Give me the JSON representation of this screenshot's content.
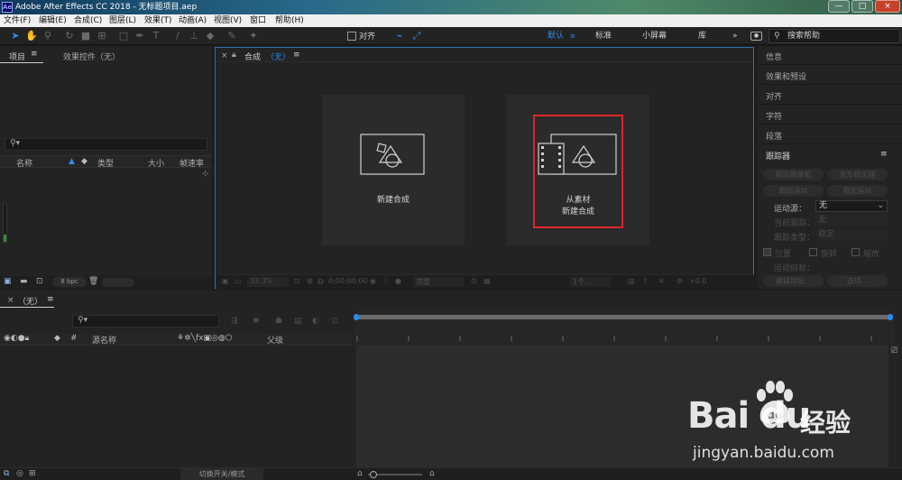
{
  "window": {
    "title": "Adobe After Effects CC 2018 - 无标题项目.aep",
    "app_icon": "Ae",
    "controls": [
      "minimize",
      "maximize",
      "close"
    ]
  },
  "menu": [
    "文件(F)",
    "编辑(E)",
    "合成(C)",
    "图层(L)",
    "效果(T)",
    "动画(A)",
    "视图(V)",
    "窗口",
    "帮助(H)"
  ],
  "toolbar": {
    "snap_label": "对齐",
    "workspaces": [
      {
        "label": "默认",
        "active": true
      },
      {
        "label": "标准",
        "active": false
      },
      {
        "label": "小屏幕",
        "active": false
      },
      {
        "label": "库",
        "active": false
      }
    ],
    "more": "»",
    "search_placeholder": "搜索帮助"
  },
  "project_panel": {
    "tab_project": "项目",
    "tab_effects": "效果控件（无）",
    "columns": [
      "名称",
      "类型",
      "大小",
      "帧速率"
    ],
    "bpc": "8 bpc"
  },
  "composition_panel": {
    "close": "×",
    "tab_label": "合成",
    "tab_value": "（无）",
    "cards": [
      {
        "label_lines": [
          "新建合成"
        ]
      },
      {
        "label_lines": [
          "从素材",
          "新建合成"
        ],
        "highlighted": true
      }
    ],
    "footer": {
      "zoom": "33.3%",
      "timecode": "0;00;00;00",
      "resolution": "完整",
      "view": "1个...",
      "offset": "+0.0"
    }
  },
  "right_panels": {
    "items": [
      "信息",
      "效果和预设",
      "对齐",
      "字符",
      "段落"
    ],
    "tracker": {
      "title": "跟踪器",
      "buttons": [
        "跟踪摄像机",
        "变形稳定器",
        "跟踪运动",
        "稳定运动"
      ],
      "motion_source_label": "运动源：",
      "motion_source_value": "无",
      "current_track_label": "当前跟踪：",
      "current_track_value": "无",
      "track_type_label": "跟踪类型：",
      "track_type_value": "稳定",
      "checkboxes": [
        {
          "label": "位置",
          "checked": true
        },
        {
          "label": "旋转",
          "checked": false
        },
        {
          "label": "缩放",
          "checked": false
        }
      ],
      "motion_target_label": "运动目标：",
      "edit_target": "编辑目标...",
      "options": "选项..."
    }
  },
  "timeline": {
    "tab_label": "（无）",
    "columns": [
      "源名称",
      "父级"
    ],
    "bottom_label": "切换开关/模式"
  },
  "watermark": {
    "brand": "Bai du",
    "brand_cn": "经验",
    "url": "jingyan.baidu.com"
  }
}
